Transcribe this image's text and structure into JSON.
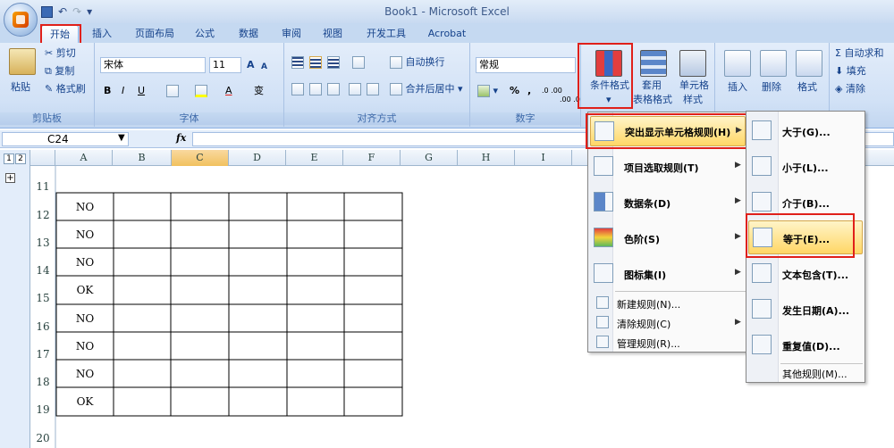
{
  "window": {
    "title": "Book1 - Microsoft Excel"
  },
  "qat": {
    "undo": "↶",
    "redo": "↷",
    "more": "▾"
  },
  "tabs": [
    "开始",
    "插入",
    "页面布局",
    "公式",
    "数据",
    "审阅",
    "视图",
    "开发工具",
    "Acrobat"
  ],
  "clipboard": {
    "paste": "粘贴",
    "cut": "剪切",
    "copy": "复制",
    "format_painter": "格式刷",
    "label": "剪贴板"
  },
  "font": {
    "name": "宋体",
    "size": "11",
    "grow": "A",
    "shrink": "A",
    "bold": "B",
    "italic": "I",
    "underline": "U",
    "label": "字体",
    "phonetic": "变"
  },
  "alignment": {
    "wrap": "自动换行",
    "merge": "合并后居中",
    "label": "对齐方式"
  },
  "number": {
    "format": "常规",
    "percent": "%",
    "comma": ",",
    "inc_decimal": ".0 .00",
    "dec_decimal": ".00 .0",
    "label": "数字"
  },
  "styles": {
    "conditional": "条件格式",
    "table_line1": "套用",
    "table_line2": "表格格式",
    "cell_line1": "单元格",
    "cell_line2": "样式"
  },
  "cells": {
    "insert": "插入",
    "delete": "删除",
    "format": "格式"
  },
  "editing": {
    "autosum": "自动求和",
    "fill": "填充",
    "clear": "清除"
  },
  "formula": {
    "name_box": "C24",
    "fx": "fx"
  },
  "outline": {
    "level1": "1",
    "level2": "2"
  },
  "columns": [
    "A",
    "B",
    "C",
    "D",
    "E",
    "F",
    "G",
    "H",
    "I"
  ],
  "rows": [
    {
      "num": "11",
      "a": ""
    },
    {
      "num": "12",
      "a": "NO"
    },
    {
      "num": "13",
      "a": "NO"
    },
    {
      "num": "14",
      "a": "NO"
    },
    {
      "num": "15",
      "a": "OK"
    },
    {
      "num": "16",
      "a": "NO"
    },
    {
      "num": "17",
      "a": "NO"
    },
    {
      "num": "18",
      "a": "NO"
    },
    {
      "num": "19",
      "a": "OK"
    },
    {
      "num": "20",
      "a": ""
    }
  ],
  "cf_menu": {
    "highlight": "突出显示单元格规则(H)",
    "top": "项目选取规则(T)",
    "databar": "数据条(D)",
    "colorscale": "色阶(S)",
    "iconset": "图标集(I)",
    "new_rule": "新建规则(N)...",
    "clear_rules": "清除规则(C)",
    "manage": "管理规则(R)..."
  },
  "sub_menu": {
    "greater": "大于(G)...",
    "less": "小于(L)...",
    "between": "介于(B)...",
    "equal": "等于(E)...",
    "text": "文本包含(T)...",
    "date": "发生日期(A)...",
    "duplicate": "重复值(D)...",
    "more": "其他规则(M)..."
  },
  "colors": {
    "highlight": "#ffd766",
    "red_box": "#e0201a",
    "ribbon": "#d1e1f6"
  }
}
